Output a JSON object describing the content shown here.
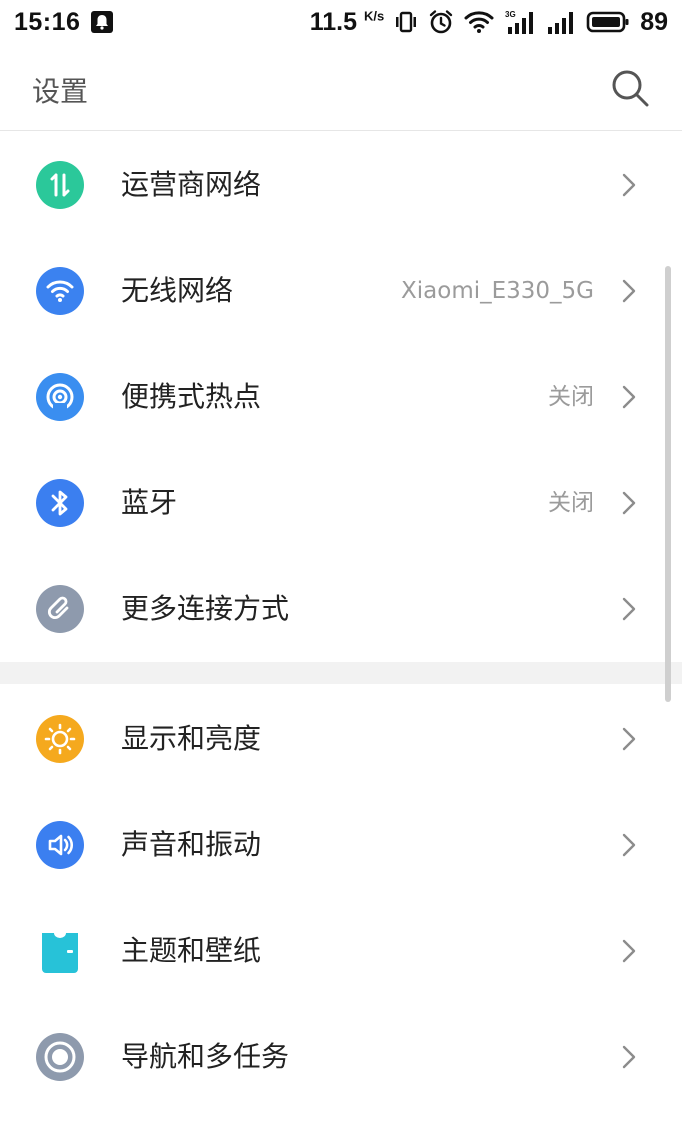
{
  "status_bar": {
    "time": "15:16",
    "network_speed": "11.5",
    "network_speed_unit": "K/s",
    "signal_label": "3G",
    "battery": "89"
  },
  "header": {
    "title": "设置"
  },
  "sections": [
    {
      "items": [
        {
          "label": "运营商网络",
          "value": "",
          "icon": "carrier-network-icon",
          "color": "#2bc89a"
        },
        {
          "label": "无线网络",
          "value": "Xiaomi_E330_5G",
          "icon": "wifi-icon",
          "color": "#3b82f0"
        },
        {
          "label": "便携式热点",
          "value": "关闭",
          "icon": "hotspot-icon",
          "color": "#3a8ef0"
        },
        {
          "label": "蓝牙",
          "value": "关闭",
          "icon": "bluetooth-icon",
          "color": "#3b7ff0"
        },
        {
          "label": "更多连接方式",
          "value": "",
          "icon": "link-icon",
          "color": "#8e9aad"
        }
      ]
    },
    {
      "items": [
        {
          "label": "显示和亮度",
          "value": "",
          "icon": "brightness-icon",
          "color": "#f5a91e"
        },
        {
          "label": "声音和振动",
          "value": "",
          "icon": "sound-icon",
          "color": "#3b7ff0"
        },
        {
          "label": "主题和壁纸",
          "value": "",
          "icon": "theme-icon",
          "color": "#27c2d8"
        },
        {
          "label": "导航和多任务",
          "value": "",
          "icon": "navigation-icon",
          "color": "#8e9aad"
        }
      ]
    }
  ]
}
